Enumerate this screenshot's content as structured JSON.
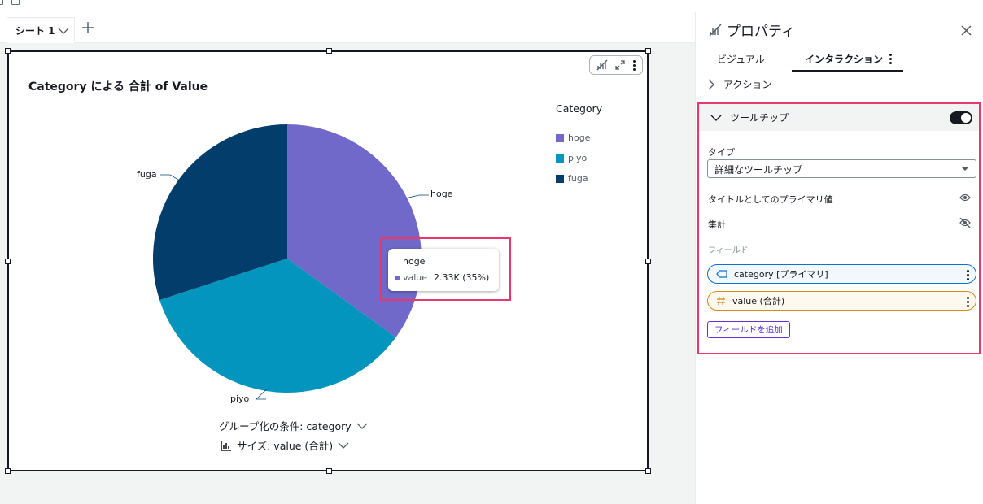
{
  "sheet": {
    "tab_label": "シート 1"
  },
  "visual": {
    "title": "Category による 合計 of Value",
    "group_by_label": "グループ化の条件: category",
    "size_label": "サイズ: value (合計)",
    "legend": {
      "title": "Category",
      "items": [
        {
          "label": "hoge",
          "color": "#7069c9"
        },
        {
          "label": "piyo",
          "color": "#0395bd"
        },
        {
          "label": "fuga",
          "color": "#033d6b"
        }
      ]
    },
    "tooltip": {
      "title": "hoge",
      "key": "value",
      "value": "2.33K (35%)"
    }
  },
  "chart_data": {
    "type": "pie",
    "categories": [
      "hoge",
      "piyo",
      "fuga"
    ],
    "values": [
      35,
      35,
      30
    ],
    "colors": [
      "#7069c9",
      "#0395bd",
      "#033d6b"
    ],
    "title": "Category による 合計 of Value"
  },
  "panel": {
    "title": "プロパティ",
    "tabs": [
      {
        "label": "ビジュアル",
        "active": false
      },
      {
        "label": "インタラクション",
        "active": true
      }
    ],
    "action_section": "アクション",
    "tooltip_section": {
      "label": "ツールチップ",
      "enabled": true,
      "type_label": "タイプ",
      "type_value": "詳細なツールチップ",
      "primary_title_label": "タイトルとしてのプライマリ値",
      "aggregate_label": "集計",
      "fields_label": "フィールド",
      "fields": [
        {
          "label": "category [プライマリ]"
        },
        {
          "label": "value (合計)"
        }
      ],
      "add_field_label": "フィールドを追加"
    }
  }
}
